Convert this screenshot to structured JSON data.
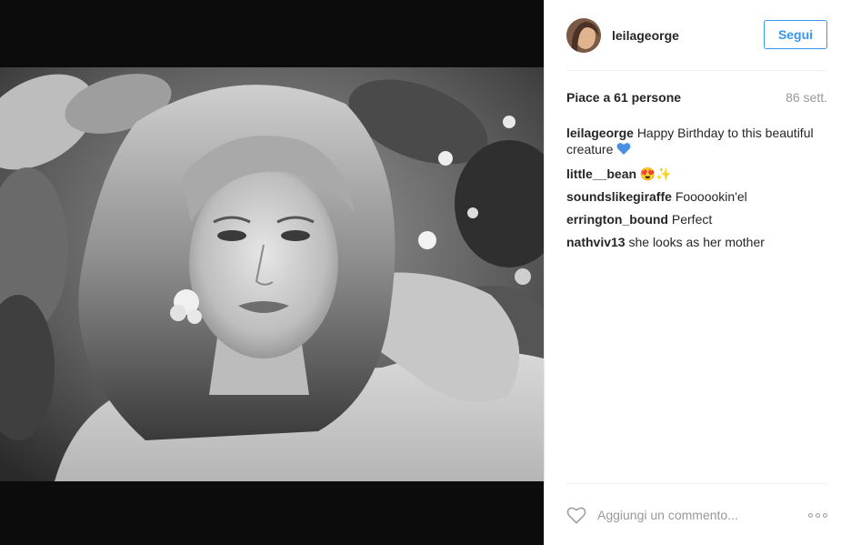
{
  "post": {
    "author": "leilageorge",
    "follow_label": "Segui",
    "likes": "Piace a 61 persone",
    "time": "86 sett.",
    "image_icon": "portrait-photo"
  },
  "comments": [
    {
      "user": "leilageorge",
      "text": "Happy Birthday to this beautiful creature",
      "emoji": "blue-heart"
    },
    {
      "user": "little__bean",
      "text": "😍✨"
    },
    {
      "user": "soundslikegiraffe",
      "text": "Foooookin'el"
    },
    {
      "user": "errington_bound",
      "text": "Perfect"
    },
    {
      "user": "nathviv13",
      "text": "she looks as her mother"
    }
  ],
  "footer": {
    "comment_placeholder": "Aggiungi un commento...",
    "like_icon": "heart-outline-icon",
    "more_icon": "more-options-icon"
  },
  "colors": {
    "accent": "#3897f0",
    "text": "#262626",
    "muted": "#999999",
    "media_bg": "#0c0c0c"
  }
}
